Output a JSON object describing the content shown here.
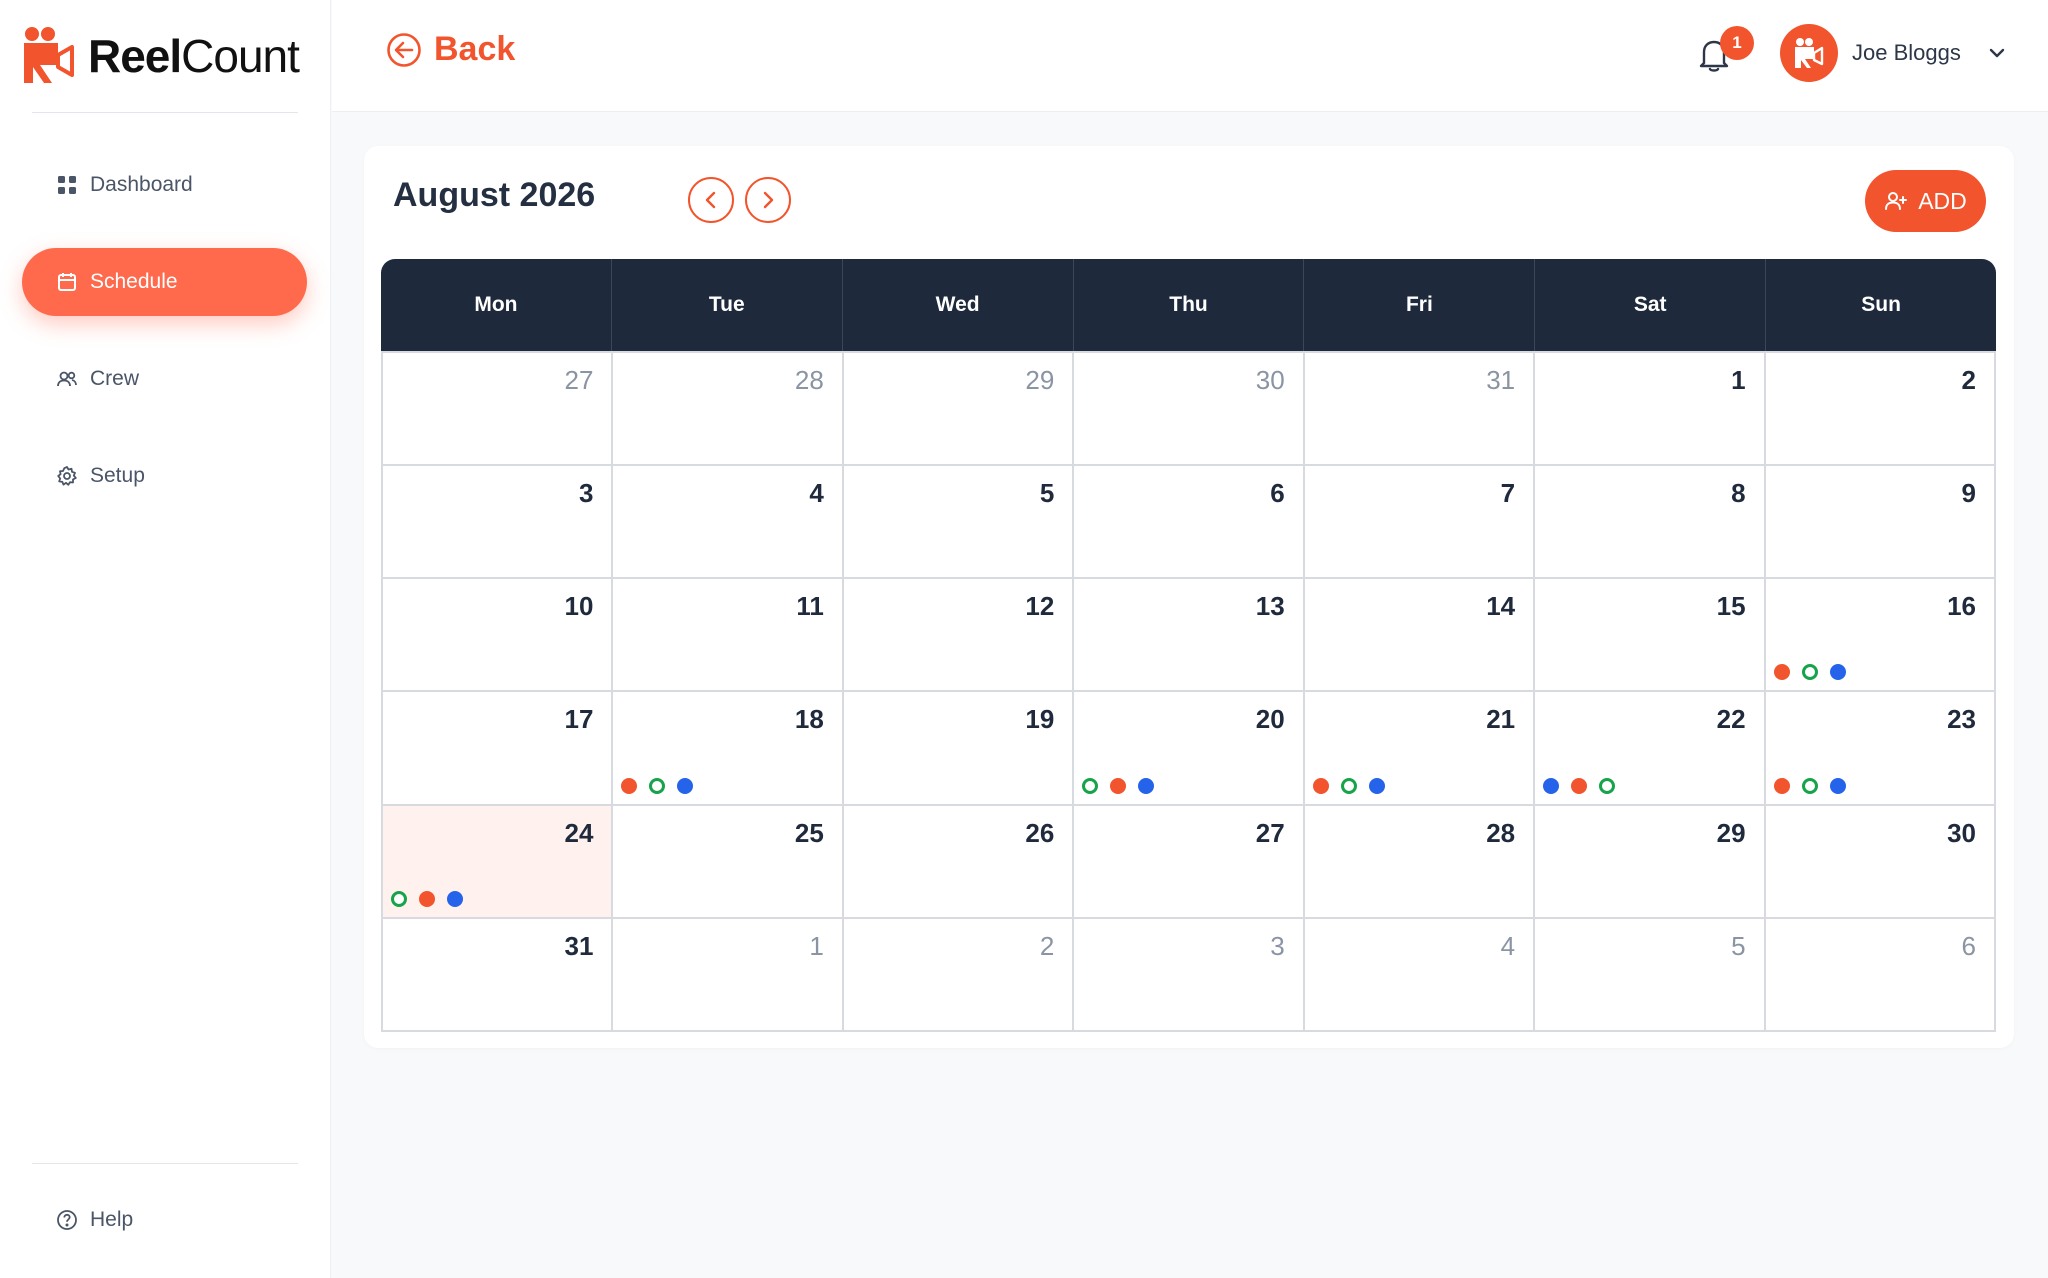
{
  "brand": {
    "name_bold": "Reel",
    "name_regular": "Count"
  },
  "sidebar": {
    "items": [
      {
        "label": "Dashboard",
        "icon": "grid-icon"
      },
      {
        "label": "Schedule",
        "icon": "calendar-icon",
        "active": true
      },
      {
        "label": "Crew",
        "icon": "users-icon"
      },
      {
        "label": "Setup",
        "icon": "gear-icon"
      }
    ],
    "help": {
      "label": "Help",
      "icon": "help-circle-icon"
    }
  },
  "topbar": {
    "back_label": "Back",
    "notifications_count": "1",
    "user_name": "Joe Bloggs"
  },
  "calendar": {
    "month_title": "August 2026",
    "add_label": "ADD",
    "weekdays": [
      "Mon",
      "Tue",
      "Wed",
      "Thu",
      "Fri",
      "Sat",
      "Sun"
    ],
    "days": [
      {
        "n": "27",
        "muted": true,
        "dots": []
      },
      {
        "n": "28",
        "muted": true,
        "dots": []
      },
      {
        "n": "29",
        "muted": true,
        "dots": []
      },
      {
        "n": "30",
        "muted": true,
        "dots": []
      },
      {
        "n": "31",
        "muted": true,
        "dots": []
      },
      {
        "n": "1",
        "dots": []
      },
      {
        "n": "2",
        "dots": []
      },
      {
        "n": "3",
        "dots": []
      },
      {
        "n": "4",
        "dots": []
      },
      {
        "n": "5",
        "dots": []
      },
      {
        "n": "6",
        "dots": []
      },
      {
        "n": "7",
        "dots": []
      },
      {
        "n": "8",
        "dots": []
      },
      {
        "n": "9",
        "dots": []
      },
      {
        "n": "10",
        "dots": []
      },
      {
        "n": "11",
        "dots": []
      },
      {
        "n": "12",
        "dots": []
      },
      {
        "n": "13",
        "dots": []
      },
      {
        "n": "14",
        "dots": []
      },
      {
        "n": "15",
        "dots": []
      },
      {
        "n": "16",
        "dots": [
          "orange",
          "ring",
          "blue"
        ]
      },
      {
        "n": "17",
        "dots": []
      },
      {
        "n": "18",
        "dots": [
          "orange",
          "ring",
          "blue"
        ]
      },
      {
        "n": "19",
        "dots": []
      },
      {
        "n": "20",
        "dots": [
          "ring",
          "orange",
          "blue"
        ]
      },
      {
        "n": "21",
        "dots": [
          "orange",
          "ring",
          "blue"
        ]
      },
      {
        "n": "22",
        "dots": [
          "blue",
          "orange",
          "ring"
        ]
      },
      {
        "n": "23",
        "dots": [
          "orange",
          "ring",
          "blue"
        ]
      },
      {
        "n": "24",
        "today": true,
        "dots": [
          "ring",
          "orange",
          "blue"
        ]
      },
      {
        "n": "25",
        "dots": []
      },
      {
        "n": "26",
        "dots": []
      },
      {
        "n": "27",
        "dots": []
      },
      {
        "n": "28",
        "dots": []
      },
      {
        "n": "29",
        "dots": []
      },
      {
        "n": "30",
        "dots": []
      },
      {
        "n": "31",
        "dots": []
      },
      {
        "n": "1",
        "muted": true,
        "dots": []
      },
      {
        "n": "2",
        "muted": true,
        "dots": []
      },
      {
        "n": "3",
        "muted": true,
        "dots": []
      },
      {
        "n": "4",
        "muted": true,
        "dots": []
      },
      {
        "n": "5",
        "muted": true,
        "dots": []
      },
      {
        "n": "6",
        "muted": true,
        "dots": []
      }
    ]
  },
  "colors": {
    "accent": "#f2542d",
    "nav_active": "#ff6a4d",
    "header_dark": "#1e2a3b",
    "event_blue": "#2563eb",
    "event_green": "#16a34a",
    "today_bg": "#fff2ee"
  }
}
